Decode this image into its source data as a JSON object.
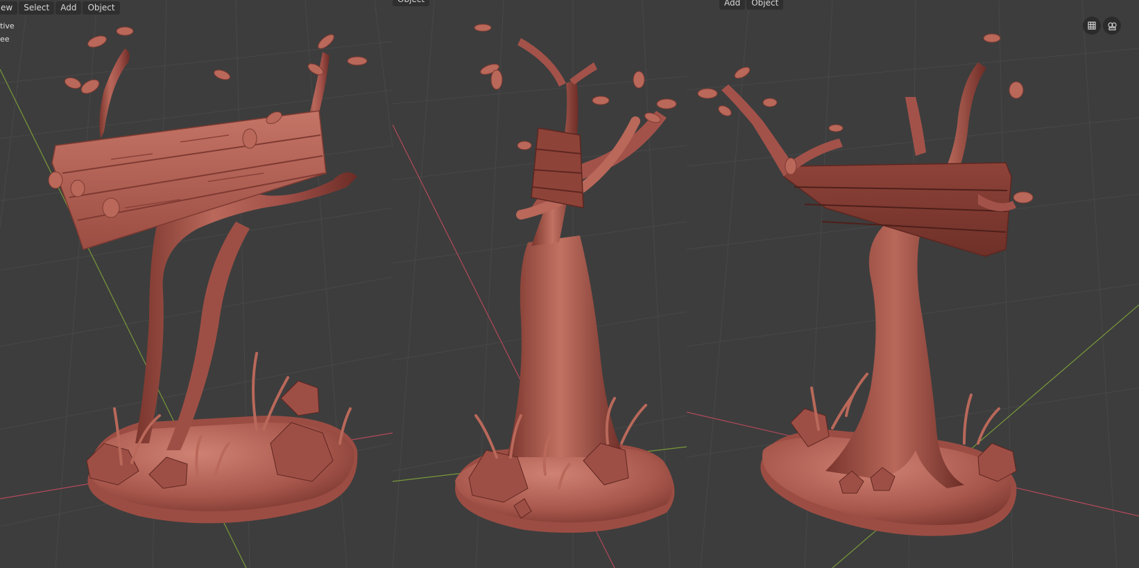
{
  "viewports": [
    {
      "id": "left",
      "menu": [
        "ew",
        "Select",
        "Add",
        "Object"
      ],
      "overlay_lines": [
        "tive",
        "ee"
      ]
    },
    {
      "id": "middle",
      "menu": [
        "Object"
      ]
    },
    {
      "id": "right",
      "menu": [
        "Add",
        "Object"
      ],
      "icons": [
        "grid-view-icon",
        "camera-view-icon"
      ]
    }
  ],
  "colors": {
    "background": "#3d3d3d",
    "grid_line": "#484848",
    "x_axis": "#b5495b",
    "y_axis": "#7a9a3a",
    "clay_base": "#a8574c",
    "clay_light": "#c97a6c",
    "clay_dark": "#6e2f28",
    "menu_bg": "#2f2f2f"
  }
}
